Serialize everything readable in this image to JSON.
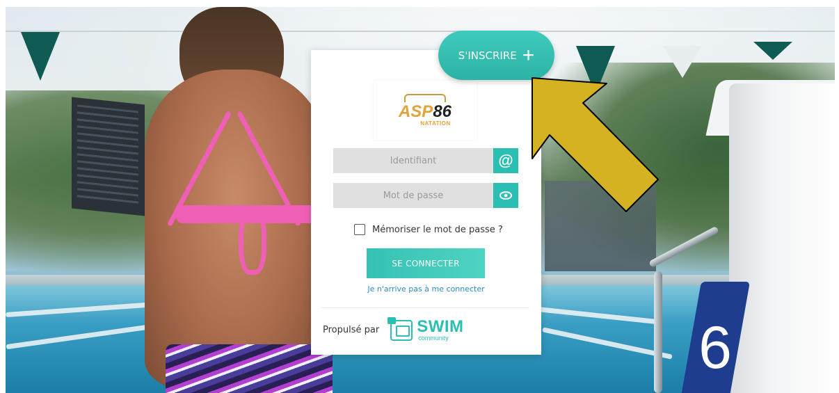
{
  "signup": {
    "label": "S'INSCRIRE",
    "icon": "plus-icon"
  },
  "logo": {
    "brand": "ASP86",
    "brand_prefix": "ASP",
    "brand_number": "86",
    "subtitle": "NATATION"
  },
  "login": {
    "username_placeholder": "Identifiant",
    "username_icon": "at-sign-icon",
    "password_placeholder": "Mot de passe",
    "password_icon": "eye-icon",
    "remember_label": "Mémoriser le mot de passe ?",
    "remember_checked": false,
    "submit_label": "SE CONNECTER",
    "forgot_link": "Je n'arrive pas à me connecter"
  },
  "footer": {
    "powered_label": "Propulsé par",
    "brand_word": "SWIM",
    "brand_sub": "community"
  },
  "background": {
    "lane_number": "6"
  },
  "colors": {
    "accent": "#2bbfb4",
    "link": "#2a8bc8",
    "arrow": "#d5b222",
    "logo_orange": "#e2a23c"
  }
}
